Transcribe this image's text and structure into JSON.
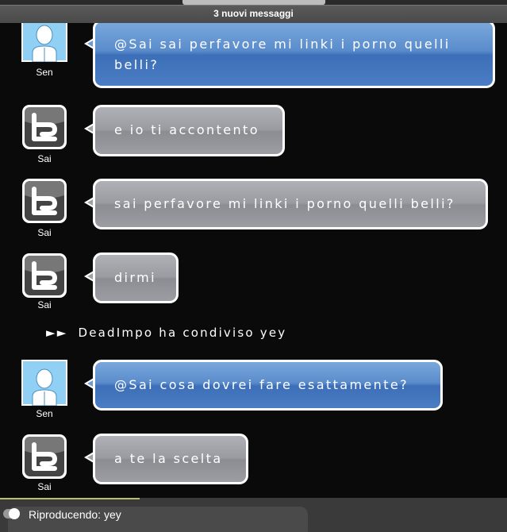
{
  "banner": {
    "new_messages": "3 nuovi messaggi"
  },
  "messages": [
    {
      "user": "Sen",
      "text": "@Sai sai perfavore mi linki i porno quelli belli?",
      "style": "blue",
      "avatar_icon": "person-avatar-icon"
    },
    {
      "user": "Sai",
      "text": "e io ti accontento",
      "style": "gray",
      "avatar_icon": "te-logo-icon"
    },
    {
      "user": "Sai",
      "text": "sai perfavore mi linki i porno quelli belli?",
      "style": "gray",
      "avatar_icon": "te-logo-icon"
    },
    {
      "user": "Sai",
      "text": "dirmi",
      "style": "gray",
      "avatar_icon": "te-logo-icon"
    },
    {
      "user": "Sen",
      "text": "@Sai cosa dovrei fare esattamente?",
      "style": "blue",
      "avatar_icon": "person-avatar-icon"
    },
    {
      "user": "Sai",
      "text": "a te la scelta",
      "style": "gray",
      "avatar_icon": "te-logo-icon"
    }
  ],
  "system_notice": {
    "prefix": "►►",
    "text": "DeadImpo ha condiviso yey"
  },
  "player": {
    "status": "Riproducendo: yey"
  },
  "colors": {
    "bubble_blue": "#4a7dc4",
    "bubble_gray": "#9c9da3",
    "background": "#0a0a0a"
  }
}
